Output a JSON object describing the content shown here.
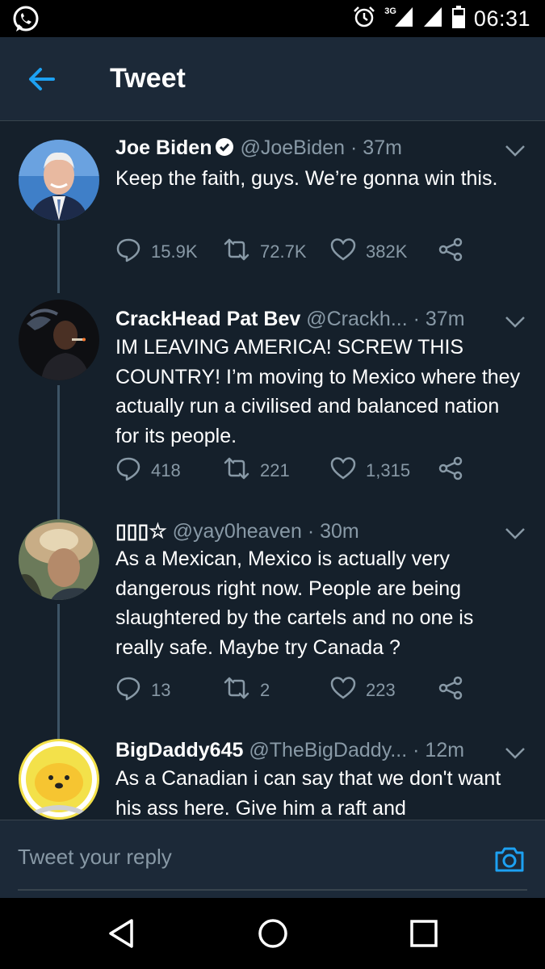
{
  "status_bar": {
    "network": "3G",
    "time": "06:31"
  },
  "header": {
    "title": "Tweet"
  },
  "tweets": [
    {
      "name": "Joe Biden",
      "verified": true,
      "handle": "@JoeBiden",
      "time": "· 37m",
      "text": "Keep the faith, guys. We’re gonna win this.",
      "replies": "15.9K",
      "retweets": "72.7K",
      "likes": "382K"
    },
    {
      "name": "CrackHead Pat Bev",
      "verified": false,
      "handle": "@Crackh...",
      "time": "· 37m",
      "text": "IM LEAVING AMERICA! SCREW THIS COUNTRY! I’m moving to Mexico where they actually run a civilised and balanced nation for its people.",
      "replies": "418",
      "retweets": "221",
      "likes": "1,315"
    },
    {
      "name": "▯▯▯☆",
      "verified": false,
      "handle": "@yay0heaven",
      "time": "· 30m",
      "text": "As a Mexican, Mexico is actually very dangerous right now. People are being slaughtered by the cartels and no one is really safe. Maybe try Canada ?",
      "replies": "13",
      "retweets": "2",
      "likes": "223"
    },
    {
      "name": "BigDaddy645",
      "verified": false,
      "handle": "@TheBigDaddy...",
      "time": "· 12m",
      "text": "As a Canadian i can say that we don't want his ass here. Give him a raft and"
    }
  ],
  "reply_bar": {
    "placeholder": "Tweet your reply"
  },
  "colors": {
    "background": "#15202b",
    "header": "#1c2938",
    "accent": "#1da1f2",
    "secondary_text": "#8899a6",
    "thread_line": "#3d5466"
  },
  "icons": {
    "status_left": "whatsapp-icon",
    "status_right": [
      "alarm-icon",
      "signal-icon",
      "signal-icon",
      "battery-icon"
    ],
    "header": "back-arrow-icon",
    "tweet_actions": [
      "reply-icon",
      "retweet-icon",
      "like-icon",
      "share-icon"
    ],
    "tweet_menu": "chevron-down-icon",
    "reply_bar": "camera-icon",
    "nav": [
      "back-triangle-icon",
      "home-circle-icon",
      "recents-square-icon"
    ]
  }
}
